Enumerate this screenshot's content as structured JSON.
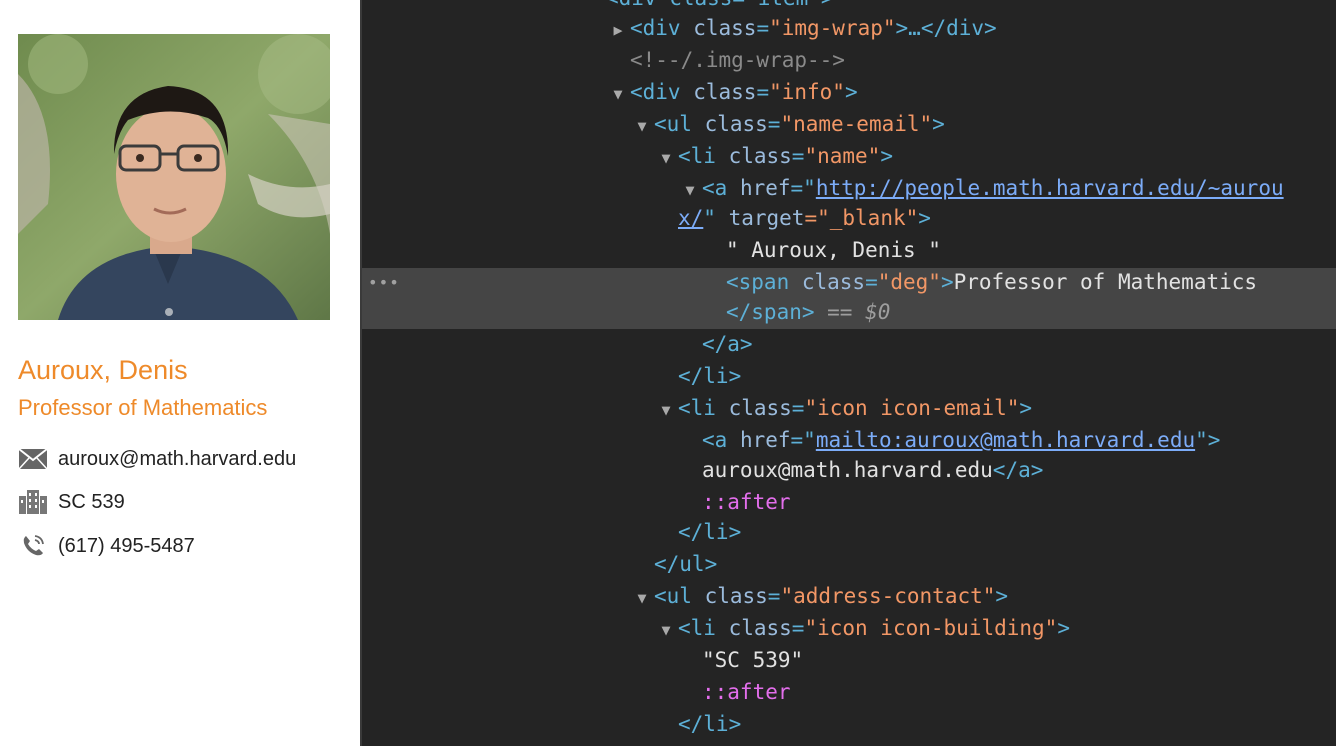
{
  "profile": {
    "name": "Auroux, Denis",
    "degree": "Professor of Mathematics",
    "email": "auroux@math.harvard.edu",
    "building": "SC 539",
    "phone": "(617) 495-5487",
    "accent_color": "#ee8a2a",
    "icons": {
      "email": "envelope-icon",
      "building": "building-icon",
      "phone": "phone-icon"
    }
  },
  "devtools": {
    "line0": "<div class=\"item\">",
    "img_wrap_open": "<div ",
    "class_attr": "class",
    "img_wrap_val": "\"img-wrap\"",
    "img_wrap_close": ">…</div>",
    "comment": "<!--/.img-wrap-->",
    "div_open": "<div ",
    "info_val": "\"info\"",
    "gt": ">",
    "ul_open": "<ul ",
    "name_email_val": "\"name-email\"",
    "li_open": "<li ",
    "name_val": "\"name\"",
    "a_open": "<a ",
    "href_attr": "href",
    "eq": "=\"",
    "href_url_1": "http://people.math.harvard.edu/~aurou",
    "href_url_2": "x/",
    "quote": "\"",
    "target_attr": " target",
    "target_val": "=\"_blank\"",
    "name_text": "\" Auroux, Denis \"",
    "span_open": "<span ",
    "deg_val": "\"deg\"",
    "deg_text": "Professor of Mathematics",
    "span_close": "</span>",
    "eq_dollar": " == $0",
    "a_close": "</a>",
    "li_close": "</li>",
    "icon_email_val": "\"icon icon-email\"",
    "mailto_url": "mailto:auroux@math.harvard.edu",
    "email_text": "auroux@math.harvard.edu",
    "after": "::after",
    "ul_close": "</ul>",
    "address_contact_val": "\"address-contact\"",
    "icon_building_val": "\"icon icon-building\"",
    "building_text": "\"SC 539\"",
    "eq_plain": "=",
    "dots": "•••",
    "tri_open": "▼",
    "tri_closed": "▶"
  }
}
